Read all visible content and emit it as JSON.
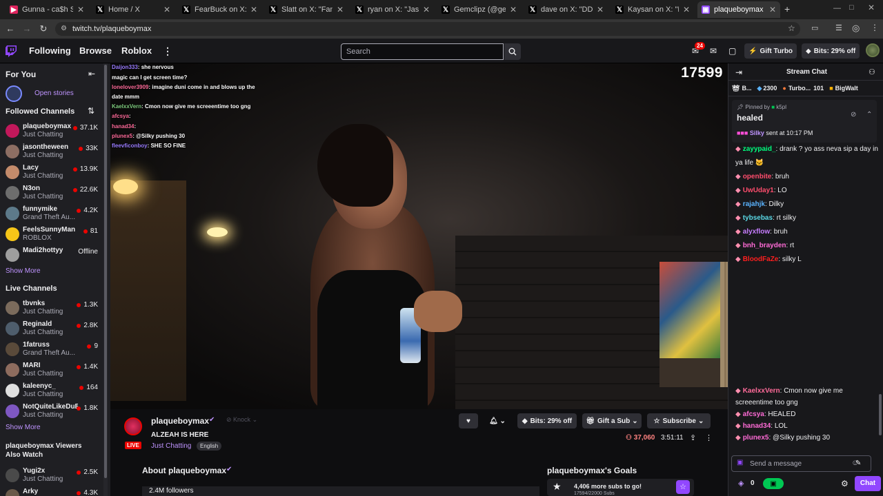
{
  "browser": {
    "tabs": [
      {
        "title": "Gunna - ca$h Shit [Of",
        "fav": "▶",
        "favcolor": "#e0245e"
      },
      {
        "title": "Home / X",
        "fav": "𝕏",
        "favcolor": "#000000"
      },
      {
        "title": "FearBuck on X: \"Stabl",
        "fav": "𝕏",
        "favcolor": "#000000"
      },
      {
        "title": "Slatt on X: \"Fanum s",
        "fav": "𝕏",
        "favcolor": "#000000"
      },
      {
        "title": "ryan on X: \"Jason",
        "fav": "𝕏",
        "favcolor": "#000000"
      },
      {
        "title": "Gemclipz (@gemclip",
        "fav": "𝕏",
        "favcolor": "#000000"
      },
      {
        "title": "dave on X: \"DDG w",
        "fav": "𝕏",
        "favcolor": "#000000"
      },
      {
        "title": "Kaysan on X: \"Happy",
        "fav": "𝕏",
        "favcolor": "#000000"
      },
      {
        "title": "plaqueboymax -",
        "fav": "▣",
        "favcolor": "#9147ff"
      }
    ],
    "url": "twitch.tv/plaqueboymax"
  },
  "nav": {
    "following": "Following",
    "browse": "Browse",
    "roblox": "Roblox",
    "search_placeholder": "Search",
    "notif_count": "24",
    "gift_turbo": "Gift Turbo",
    "bits_offer": "Bits: 29% off"
  },
  "sidebar": {
    "for_you": "For You",
    "open_stories": "Open stories",
    "followed_header": "Followed Channels",
    "followed": [
      {
        "name": "plaqueboymax",
        "game": "Just Chatting",
        "viewers": "37.1K",
        "color": "#c2185b",
        "live": true
      },
      {
        "name": "jasontheween",
        "game": "Just Chatting",
        "viewers": "33K",
        "color": "#8d6e63",
        "live": true
      },
      {
        "name": "Lacy",
        "game": "Just Chatting",
        "viewers": "13.9K",
        "color": "#c48b6b",
        "live": true
      },
      {
        "name": "N3on",
        "game": "Just Chatting",
        "viewers": "22.6K",
        "color": "#6d6d6d",
        "live": true
      },
      {
        "name": "funnymike",
        "game": "Grand Theft Au...",
        "viewers": "4.2K",
        "color": "#5d7a8a",
        "live": true
      },
      {
        "name": "FeelsSunnyMan",
        "game": "ROBLOX",
        "viewers": "81",
        "color": "#f5c518",
        "live": true
      },
      {
        "name": "Madi2hottyy",
        "game": "",
        "viewers": "Offline",
        "color": "#9e9e9e",
        "live": false
      }
    ],
    "show_more": "Show More",
    "live_header": "Live Channels",
    "live": [
      {
        "name": "tbvnks",
        "game": "Just Chatting",
        "viewers": "1.3K",
        "color": "#7b6b5c"
      },
      {
        "name": "Reginald",
        "game": "Just Chatting",
        "viewers": "2.8K",
        "color": "#4e5d6c"
      },
      {
        "name": "1fatruss",
        "game": "Grand Theft Au...",
        "viewers": "9",
        "color": "#5a4a3a"
      },
      {
        "name": "MARI",
        "game": "Just Chatting",
        "viewers": "1.4K",
        "color": "#8e6c5e"
      },
      {
        "name": "kaleenyc_",
        "game": "Just Chatting",
        "viewers": "164",
        "color": "#e0e0e0"
      },
      {
        "name": "NotQuiteLikeDuB",
        "game": "Just Chatting",
        "viewers": "1.8K",
        "color": "#7e57c2"
      }
    ],
    "show_more2": "Show More",
    "also_watch_header": "plaqueboymax Viewers Also Watch",
    "also": [
      {
        "name": "Yugi2x",
        "game": "Just Chatting",
        "viewers": "2.5K",
        "color": "#4a4a4a"
      },
      {
        "name": "Arky",
        "game": "",
        "viewers": "4.3K",
        "color": "#6a5a4a"
      }
    ]
  },
  "video": {
    "counter": "17599",
    "overlay_chat": [
      {
        "user": "Daijon333",
        "color": "#9a7cff",
        "msg": "she nervous"
      },
      {
        "user": "",
        "color": "#9a7cff",
        "msg": "magic can I get screen time?"
      },
      {
        "user": "lonelover3909",
        "color": "#ff6b9a",
        "msg": "imagine duni come in and blows up the"
      },
      {
        "user": "",
        "color": "#ffffff",
        "msg": "date mmm"
      },
      {
        "user": "KaelxxVern",
        "color": "#7ecb7e",
        "msg": "Cmon now give me screeentime too gng"
      },
      {
        "user": "afcsya",
        "color": "#ff6b9a",
        "msg": ""
      },
      {
        "user": "hanad34",
        "color": "#ff6b9a",
        "msg": ""
      },
      {
        "user": "plunex5",
        "color": "#ff6b9a",
        "msg": "@Silky pushing 30"
      },
      {
        "user": "fleevficonboy",
        "color": "#9a7cff",
        "msg": "SHE SO FINE"
      }
    ]
  },
  "stream": {
    "streamer": "plaqueboymax",
    "live_label": "LIVE",
    "title": "ALZEAH IS HERE",
    "category": "Just Chatting",
    "tag": "English",
    "knock": "Knock",
    "bits_offer": "Bits: 29% off",
    "gift_sub": "Gift a Sub",
    "subscribe": "Subscribe",
    "viewers": "37,060",
    "uptime": "3:51:11",
    "about_header": "About plaqueboymax",
    "followers": "2.4M followers",
    "goals_header": "plaqueboymax's Goals",
    "goal_text": "4,406 more subs to go!",
    "goal_sub": "17594/22000 Subs",
    "goal_fraction": 0.8
  },
  "chat": {
    "header": "Stream Chat",
    "leaderboard": [
      {
        "name": "B...",
        "rank_icon": "👑"
      },
      {
        "value": "2300",
        "name": "Turbo...",
        "icon": "💎"
      },
      {
        "value": "101",
        "name": "BigWalt",
        "icon": "🎁"
      }
    ],
    "pinned_by_label": "Pinned by",
    "pinned_by_user": "k5pl",
    "pinned_message": "healed",
    "pinned_sender": "Silky",
    "pinned_time": "sent at 10:17 PM",
    "messages": [
      {
        "user": "zayypaid_",
        "color": "#00ff7f",
        "msg": ": drank ? yo ass neva sip a day in"
      },
      {
        "user": "",
        "color": "#efeff1",
        "msg": "ya life 🐱"
      },
      {
        "user": "openbite",
        "color": "#ff4d6d",
        "msg": ": bruh"
      },
      {
        "user": "UwUday1",
        "color": "#ff4d6d",
        "msg": ": LO"
      },
      {
        "user": "rajahjk",
        "color": "#5ab3ff",
        "msg": ": Dilky"
      },
      {
        "user": "tybsebas",
        "color": "#5ad8e6",
        "msg": ": rt silky"
      },
      {
        "user": "alyxflow",
        "color": "#c77dff",
        "msg": ": bruh"
      },
      {
        "user": "bnh_brayden",
        "color": "#ff6bd6",
        "msg": ": rt"
      },
      {
        "user": "BloodFaZe",
        "color": "#ff1f1f",
        "msg": ": silky L"
      }
    ],
    "messages_bottom": [
      {
        "user": "KaelxxVern",
        "color": "#ff6b9a",
        "msg": ": Cmon now give me"
      },
      {
        "user": "",
        "color": "#efeff1",
        "msg": "screeentime too gng"
      },
      {
        "user": "afcsya",
        "color": "#ff6bd6",
        "msg": ": HEALED"
      },
      {
        "user": "hanad34",
        "color": "#ff6bd6",
        "msg": ": LOL"
      },
      {
        "user": "plunex5",
        "color": "#ff6bd6",
        "msg": ": @Silky pushing 30"
      }
    ],
    "input_placeholder": "Send a message",
    "points": "0",
    "chat_button": "Chat"
  },
  "colors": {
    "accent": "#9147ff",
    "live": "#eb0400",
    "bg": "#0e0e10"
  }
}
